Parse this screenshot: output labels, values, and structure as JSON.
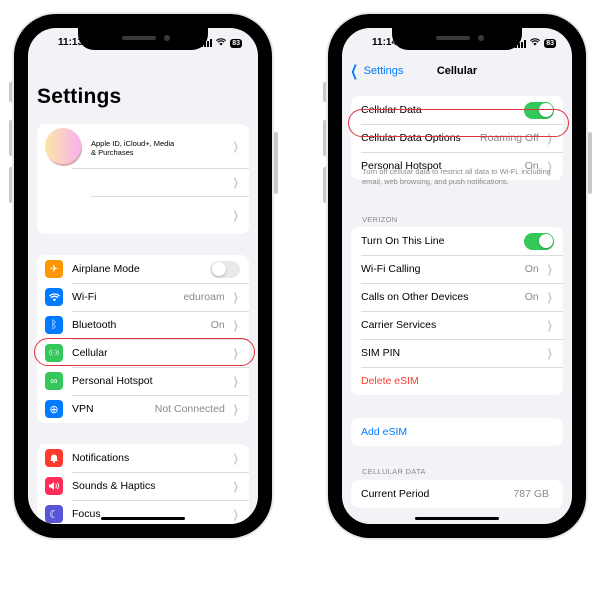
{
  "left_phone": {
    "status": {
      "time": "11:13",
      "battery": "83"
    },
    "title": "Settings",
    "profile": {
      "text_line1": "Apple ID, iCloud+, Media",
      "text_line2": "& Purchases"
    },
    "connectivity": [
      {
        "label": "Airplane Mode",
        "icon": "airplane-icon",
        "color": "#ff9500",
        "glyph": "✈",
        "toggle": "off"
      },
      {
        "label": "Wi-Fi",
        "icon": "wifi-icon",
        "color": "#007aff",
        "glyph": "◠",
        "value": "eduroam"
      },
      {
        "label": "Bluetooth",
        "icon": "bluetooth-icon",
        "color": "#007aff",
        "glyph": "ᛒ",
        "value": "On"
      },
      {
        "label": "Cellular",
        "icon": "antenna-icon",
        "color": "#34c759",
        "glyph": "((·))",
        "value": ""
      },
      {
        "label": "Personal Hotspot",
        "icon": "link-icon",
        "color": "#34c759",
        "glyph": "∞",
        "value": ""
      },
      {
        "label": "VPN",
        "icon": "globe-icon",
        "color": "#007aff",
        "glyph": "⊕",
        "value": "Not Connected"
      }
    ],
    "notifications_group": [
      {
        "label": "Notifications",
        "icon": "bell-icon",
        "color": "#ff3b30",
        "glyph": "🔔︎"
      },
      {
        "label": "Sounds & Haptics",
        "icon": "speaker-icon",
        "color": "#ff2d55",
        "glyph": "◀)"
      },
      {
        "label": "Focus",
        "icon": "moon-icon",
        "color": "#5856d6",
        "glyph": "☾"
      }
    ]
  },
  "right_phone": {
    "status": {
      "time": "11:14",
      "battery": "83"
    },
    "nav": {
      "back_label": "Settings",
      "title": "Cellular"
    },
    "group1": [
      {
        "label": "Cellular Data",
        "toggle": "on"
      },
      {
        "label": "Cellular Data Options",
        "value": "Roaming Off"
      },
      {
        "label": "Personal Hotspot",
        "value": "On"
      }
    ],
    "footnote": "Turn off cellular data to restrict all data to Wi-Fi, including email, web browsing, and push notifications.",
    "carrier_header": "VERIZON",
    "carrier_group": [
      {
        "label": "Turn On This Line",
        "toggle": "on"
      },
      {
        "label": "Wi-Fi Calling",
        "value": "On"
      },
      {
        "label": "Calls on Other Devices",
        "value": "On"
      },
      {
        "label": "Carrier Services",
        "value": ""
      },
      {
        "label": "SIM PIN",
        "value": ""
      },
      {
        "label": "Delete eSIM",
        "style": "destructive"
      }
    ],
    "add_esim": "Add eSIM",
    "cellular_data_header": "CELLULAR DATA",
    "current_period": {
      "label": "Current Period",
      "value": "787 GB"
    }
  },
  "colors": {
    "highlight": "#e0343f",
    "toggle_on": "#34c759",
    "link_blue": "#007aff",
    "destructive_red": "#ff3b30"
  }
}
